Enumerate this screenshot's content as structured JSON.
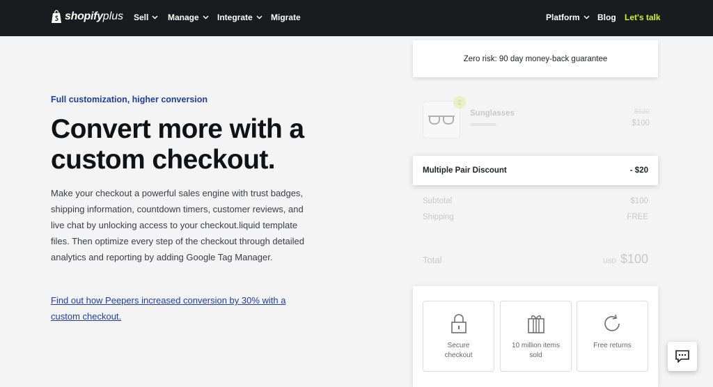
{
  "nav": {
    "logo_word": "shopify",
    "logo_plus": "plus",
    "left_items": [
      {
        "label": "Sell",
        "has_dropdown": true
      },
      {
        "label": "Manage",
        "has_dropdown": true
      },
      {
        "label": "Integrate",
        "has_dropdown": true
      },
      {
        "label": "Migrate",
        "has_dropdown": false
      }
    ],
    "right_items": [
      {
        "label": "Platform",
        "has_dropdown": true
      },
      {
        "label": "Blog",
        "has_dropdown": false
      },
      {
        "label": "Let's talk",
        "has_dropdown": false
      }
    ]
  },
  "hero": {
    "eyebrow": "Full customization, higher conversion",
    "headline": "Convert more with a custom checkout.",
    "body": "Make your checkout a powerful sales engine with trust badges, shipping information, countdown timers, customer reviews, and live chat by unlocking access to your checkout.liquid template files. Then optimize every step of the checkout through detailed analytics and reporting by adding Google Tag Manager.",
    "link": "Find out how Peepers increased conversion by 30% with a custom checkout."
  },
  "checkout": {
    "guarantee": "Zero risk: 90 day money-back guarantee",
    "product": {
      "name": "Sunglasses",
      "quantity": "2",
      "old_price": "$120",
      "price": "$100"
    },
    "discount": {
      "label": "Multiple Pair Discount",
      "value": "- $20"
    },
    "subtotal": {
      "label": "Subtotal",
      "value": "$100"
    },
    "shipping": {
      "label": "Shipping",
      "value": "FREE"
    },
    "total": {
      "label": "Total",
      "currency": "USD",
      "value": "$100"
    },
    "trust_badges": [
      {
        "icon": "lock-icon",
        "label": "Secure checkout"
      },
      {
        "icon": "gift-icon",
        "label": "10 million items sold"
      },
      {
        "icon": "refresh-icon",
        "label": "Free returns"
      }
    ]
  },
  "colors": {
    "nav_bg": "#1a1b1e",
    "cta": "#d0f224",
    "link": "#1d3ca8",
    "page_bg": "#f4f4f5",
    "quantity_badge": "#cfe840"
  }
}
